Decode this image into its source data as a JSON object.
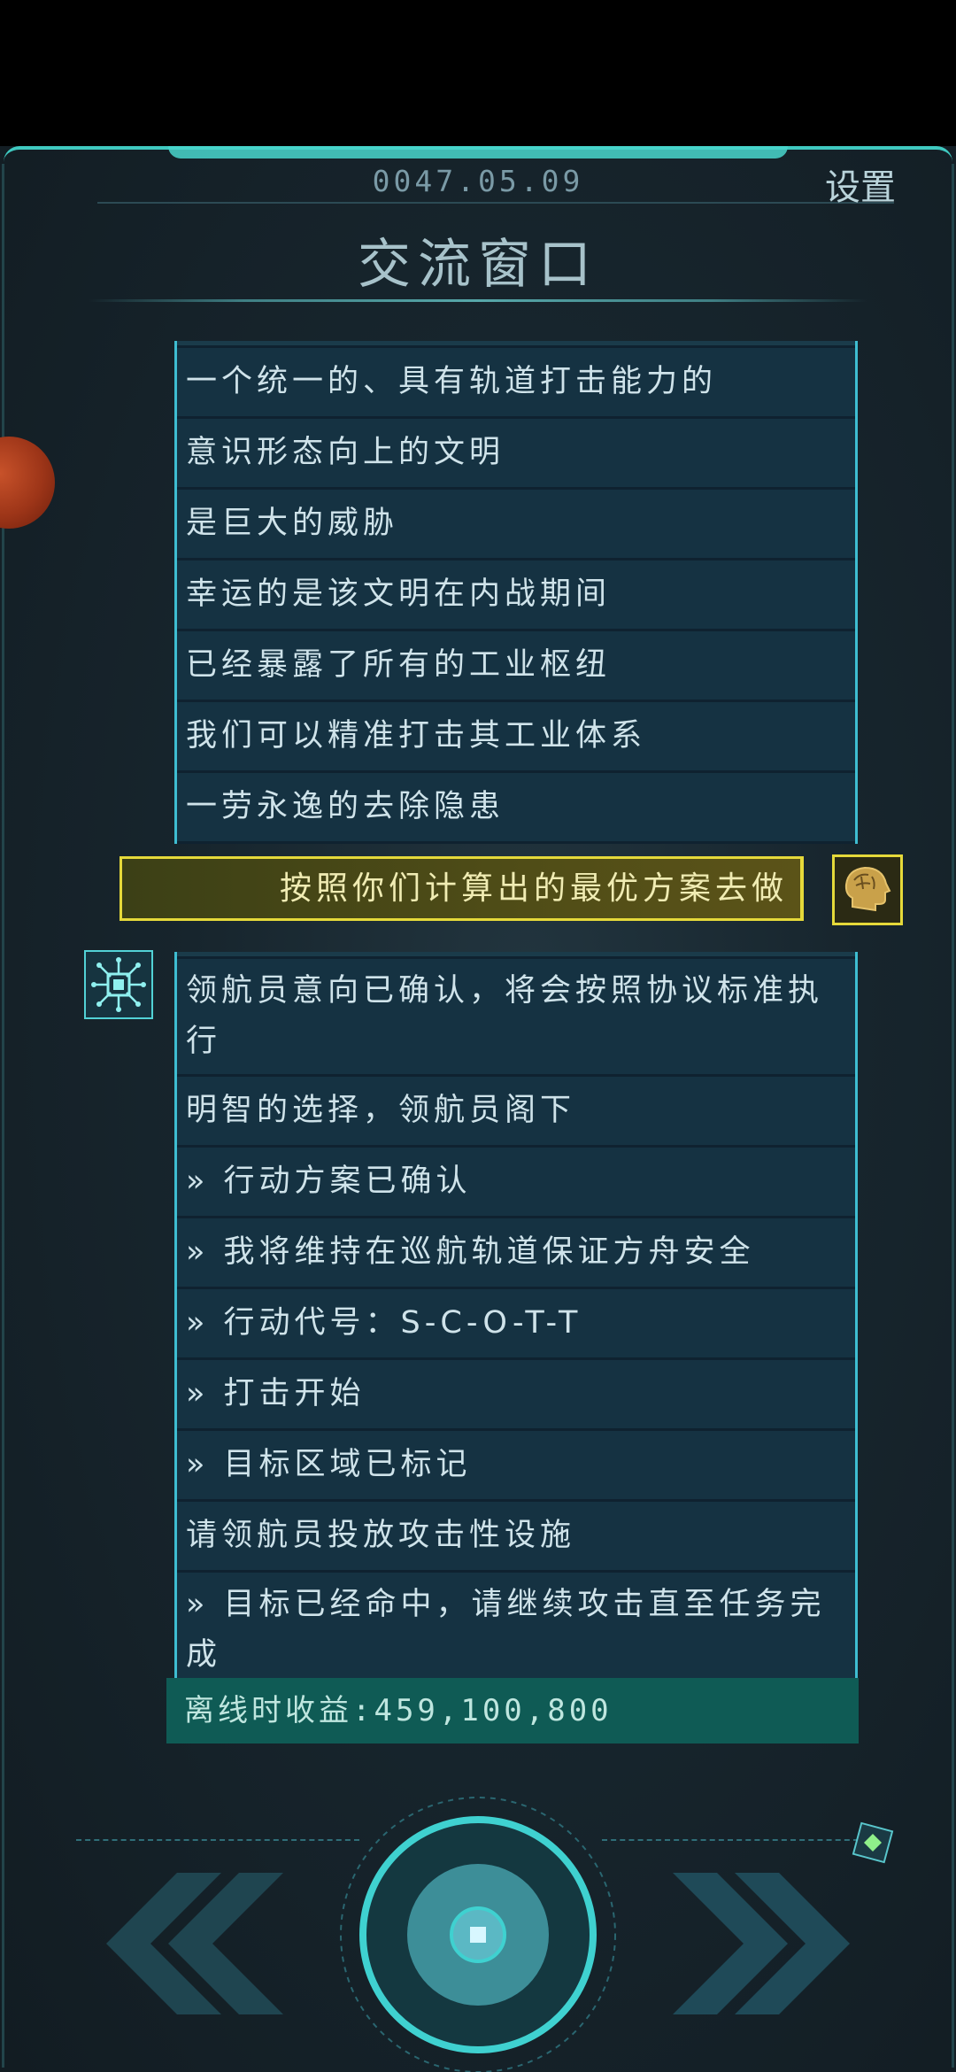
{
  "header": {
    "date": "0047.05.09",
    "settings_label": "设置",
    "title": "交流窗口"
  },
  "chat_block_1": {
    "lines": [
      "一个统一的、具有轨道打击能力的",
      "意识形态向上的文明",
      "是巨大的威胁",
      "幸运的是该文明在内战期间",
      "已经暴露了所有的工业枢纽",
      "我们可以精准打击其工业体系",
      "一劳永逸的去除隐患"
    ]
  },
  "player_reply": "按照你们计算出的最优方案去做",
  "chat_block_2": {
    "lines": [
      "领航员意向已确认，将会按照协议标准执行",
      "明智的选择，领航员阁下",
      "» 行动方案已确认",
      "» 我将维持在巡航轨道保证方舟安全",
      "» 行动代号：S-C-O-T-T",
      "» 打击开始",
      "» 目标区域已标记",
      "请领航员投放攻击性设施",
      "» 目标已经命中，请继续攻击直至任务完成"
    ]
  },
  "offline_earnings": "离线时收益:459,100,800",
  "icons": {
    "ai_avatar": "circuit-chip-icon",
    "player_avatar": "brain-head-icon",
    "prev": "double-chevron-left-icon",
    "next": "double-chevron-right-icon",
    "center": "round-action-button-icon",
    "diamond": "diamond-icon"
  },
  "colors": {
    "accent_cyan": "#3ebdd1",
    "player_yellow": "#e5d93a",
    "offline_green": "#0f5b55"
  }
}
